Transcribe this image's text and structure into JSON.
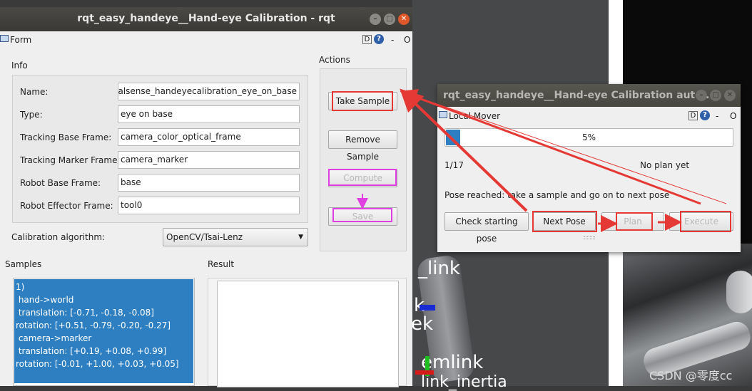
{
  "main_window": {
    "title": "rqt_easy_handeye__Hand-eye Calibration - rqt",
    "form_label": "Form",
    "d_label": "D",
    "q_label": "?",
    "dash_label": "-",
    "o_label": "O"
  },
  "info": {
    "header": "Info",
    "fields": [
      {
        "label": "Name:",
        "value": "realsense_handeyecalibration_eye_on_base/"
      },
      {
        "label": "Type:",
        "value": "eye on base"
      },
      {
        "label": "Tracking Base Frame:",
        "value": "camera_color_optical_frame"
      },
      {
        "label": "Tracking Marker Frame:",
        "value": "camera_marker"
      },
      {
        "label": "Robot Base Frame:",
        "value": "base"
      },
      {
        "label": "Robot Effector Frame:",
        "value": "tool0"
      }
    ],
    "algorithm_label": "Calibration algorithm:",
    "algorithm_value": "OpenCV/Tsai-Lenz"
  },
  "actions": {
    "header": "Actions",
    "take_sample": "Take Sample",
    "remove_sample": "Remove Sample",
    "compute": "Compute",
    "save": "Save"
  },
  "samples": {
    "header": "Samples",
    "lines": [
      "1)",
      " hand->world",
      " translation: [-0.71, -0.18, -0.08]",
      "rotation: [+0.51, -0.79, -0.20, -0.27]",
      " camera->marker",
      " translation: [+0.19, +0.08, +0.99]",
      "rotation: [-0.01, +1.00, +0.03, +0.05]"
    ]
  },
  "result": {
    "header": "Result"
  },
  "auto_window": {
    "title": "rqt_easy_handeye__Hand-eye Calibration auto...",
    "local_mover_label": "Local Mover",
    "d_label": "D",
    "q_label": "?",
    "dash_label": "-",
    "o_label": "O",
    "progress": 0.05,
    "progress_text": "5%",
    "counter": "1/17",
    "plan_status": "No plan yet",
    "pose_status": "Pose reached: take a sample and go on to next pose",
    "check_starting_pose": "Check starting pose",
    "next_pose": "Next Pose",
    "plan": "Plan",
    "execute": "Execute"
  },
  "background": {
    "label_link_1": "_link",
    "label_k": "k",
    "label_ek": "ek",
    "label_emlink": "emlink",
    "label_bottom": "link_inertia",
    "watermark": "CSDN @零度cc"
  },
  "colors": {
    "annotation_red": "#e53935",
    "annotation_magenta": "#e040e0",
    "selection_blue": "#2e7fc2"
  }
}
